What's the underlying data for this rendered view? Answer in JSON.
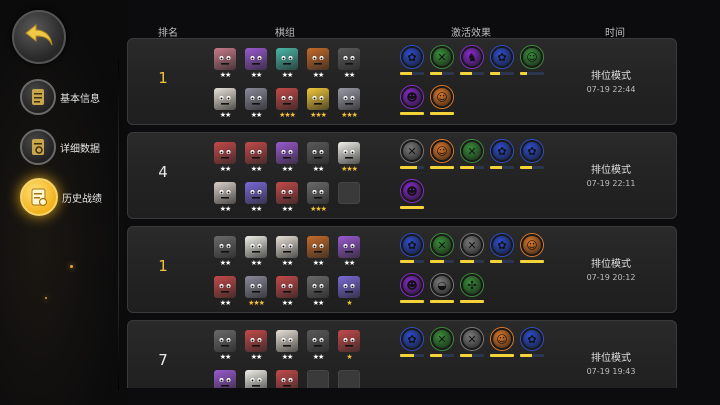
{
  "sidebar": {
    "back_icon": "back-arrow-icon",
    "items": [
      {
        "label": "基本信息",
        "icon": "document-icon",
        "active": false
      },
      {
        "label": "详细数据",
        "icon": "data-report-icon",
        "active": false
      },
      {
        "label": "历史战绩",
        "icon": "history-record-icon",
        "active": true
      }
    ]
  },
  "header": {
    "rank": "排名",
    "lineup": "棋组",
    "traits": "激活效果",
    "time": "时间"
  },
  "colors": {
    "gold": "#f3c23b",
    "trait_blue": "#2f4fd0",
    "trait_green": "#3a8f3a",
    "trait_purple": "#8a2bd0",
    "trait_orange": "#e07a2a",
    "trait_gray": "#7b7b7b"
  },
  "matches": [
    {
      "rank": "1",
      "rank_color": "gold",
      "mode": "排位模式",
      "time": "07-19 22:44",
      "units": [
        [
          {
            "c": "#c87a8a",
            "s": "★★",
            "g": false
          },
          {
            "c": "#9a5ad0",
            "s": "★★",
            "g": false
          },
          {
            "c": "#4ab8a8",
            "s": "★★",
            "g": false
          },
          {
            "c": "#c66b2a",
            "s": "★★",
            "g": false
          },
          {
            "c": "#5a5a5a",
            "s": "★★",
            "g": false
          }
        ],
        [
          {
            "c": "#e8e2d8",
            "s": "★★",
            "g": false
          },
          {
            "c": "#8a8a9a",
            "s": "★★",
            "g": false
          },
          {
            "c": "#c44a4a",
            "s": "★★★",
            "g": true
          },
          {
            "c": "#f2c83a",
            "s": "★★★",
            "g": true
          },
          {
            "c": "#9a9aa8",
            "s": "★★★",
            "g": true
          }
        ]
      ],
      "traits": [
        [
          {
            "c": "#2f4fd0",
            "i": "✿",
            "f": 0.5
          },
          {
            "c": "#3a8f3a",
            "i": "✕",
            "f": 0.5
          },
          {
            "c": "#8a2bd0",
            "i": "♞",
            "f": 0.5
          },
          {
            "c": "#2f4fd0",
            "i": "✿",
            "f": 0.4
          },
          {
            "c": "#3a8f3a",
            "i": "☺",
            "f": 0.3
          }
        ],
        [
          {
            "c": "#8a2bd0",
            "i": "☻",
            "f": 1.0
          },
          {
            "c": "#e07a2a",
            "i": "☺",
            "f": 1.0
          }
        ]
      ]
    },
    {
      "rank": "4",
      "rank_color": "white",
      "mode": "排位模式",
      "time": "07-19 22:11",
      "units": [
        [
          {
            "c": "#c44a4a",
            "s": "★★",
            "g": false
          },
          {
            "c": "#c44a4a",
            "s": "★★",
            "g": false
          },
          {
            "c": "#9a5ad0",
            "s": "★★",
            "g": false
          },
          {
            "c": "#5a5a5a",
            "s": "★★",
            "g": false
          },
          {
            "c": "#f0efe8",
            "s": "★★★",
            "g": true
          }
        ],
        [
          {
            "c": "#d8cfc8",
            "s": "★★",
            "g": false
          },
          {
            "c": "#7a6ad8",
            "s": "★★",
            "g": false
          },
          {
            "c": "#c44a4a",
            "s": "★★",
            "g": false
          },
          {
            "c": "#6a6a6a",
            "s": "★★★",
            "g": true
          },
          {
            "c": "",
            "s": "",
            "g": false
          }
        ]
      ],
      "traits": [
        [
          {
            "c": "#7b7b7b",
            "i": "✕",
            "f": 0.7
          },
          {
            "c": "#e07a2a",
            "i": "☺",
            "f": 1.0
          },
          {
            "c": "#3a8f3a",
            "i": "✕",
            "f": 0.6
          },
          {
            "c": "#2f4fd0",
            "i": "✿",
            "f": 0.5
          },
          {
            "c": "#2f4fd0",
            "i": "✿",
            "f": 0.5
          }
        ],
        [
          {
            "c": "#8a2bd0",
            "i": "☻",
            "f": 1.0
          }
        ]
      ]
    },
    {
      "rank": "1",
      "rank_color": "gold",
      "mode": "排位模式",
      "time": "07-19 20:12",
      "units": [
        [
          {
            "c": "#6a6a6a",
            "s": "★★",
            "g": false
          },
          {
            "c": "#f0efe8",
            "s": "★★",
            "g": false
          },
          {
            "c": "#e8e2d8",
            "s": "★★",
            "g": false
          },
          {
            "c": "#c66b2a",
            "s": "★★",
            "g": false
          },
          {
            "c": "#9a5ad0",
            "s": "★★",
            "g": false
          }
        ],
        [
          {
            "c": "#c44a4a",
            "s": "★★",
            "g": false
          },
          {
            "c": "#8a8a9a",
            "s": "★★★",
            "g": true
          },
          {
            "c": "#c44a4a",
            "s": "★★",
            "g": false
          },
          {
            "c": "#6a6a6a",
            "s": "★★",
            "g": false
          },
          {
            "c": "#7a6ad8",
            "s": "★",
            "g": true
          }
        ]
      ],
      "traits": [
        [
          {
            "c": "#2f4fd0",
            "i": "✿",
            "f": 0.6
          },
          {
            "c": "#3a8f3a",
            "i": "✕",
            "f": 0.6
          },
          {
            "c": "#7b7b7b",
            "i": "✕",
            "f": 0.6
          },
          {
            "c": "#2f4fd0",
            "i": "✿",
            "f": 0.5
          },
          {
            "c": "#e07a2a",
            "i": "☺",
            "f": 1.0
          }
        ],
        [
          {
            "c": "#8a2bd0",
            "i": "☻",
            "f": 1.0
          },
          {
            "c": "#7b7b7b",
            "i": "◒",
            "f": 1.0
          },
          {
            "c": "#3a8f3a",
            "i": "✣",
            "f": 1.0
          }
        ]
      ]
    },
    {
      "rank": "7",
      "rank_color": "white",
      "mode": "排位模式",
      "time": "07-19 19:43",
      "units": [
        [
          {
            "c": "#6a6a6a",
            "s": "★★",
            "g": false
          },
          {
            "c": "#c44a4a",
            "s": "★★",
            "g": false
          },
          {
            "c": "#e8e2d8",
            "s": "★★",
            "g": false
          },
          {
            "c": "#5a5a5a",
            "s": "★★",
            "g": false
          },
          {
            "c": "#c44a4a",
            "s": "★",
            "g": true
          }
        ],
        [
          {
            "c": "#9a5ad0",
            "s": "",
            "g": false
          },
          {
            "c": "#f0efe8",
            "s": "",
            "g": false
          },
          {
            "c": "#c44a4a",
            "s": "",
            "g": false
          },
          {
            "c": "",
            "s": "",
            "g": false
          },
          {
            "c": "",
            "s": "",
            "g": false
          }
        ]
      ],
      "traits": [
        [
          {
            "c": "#2f4fd0",
            "i": "✿",
            "f": 0.6
          },
          {
            "c": "#3a8f3a",
            "i": "✕",
            "f": 0.5
          },
          {
            "c": "#7b7b7b",
            "i": "✕",
            "f": 0.5
          },
          {
            "c": "#e07a2a",
            "i": "☺",
            "f": 1.0
          },
          {
            "c": "#2f4fd0",
            "i": "✿",
            "f": 0.5
          }
        ],
        []
      ]
    }
  ]
}
